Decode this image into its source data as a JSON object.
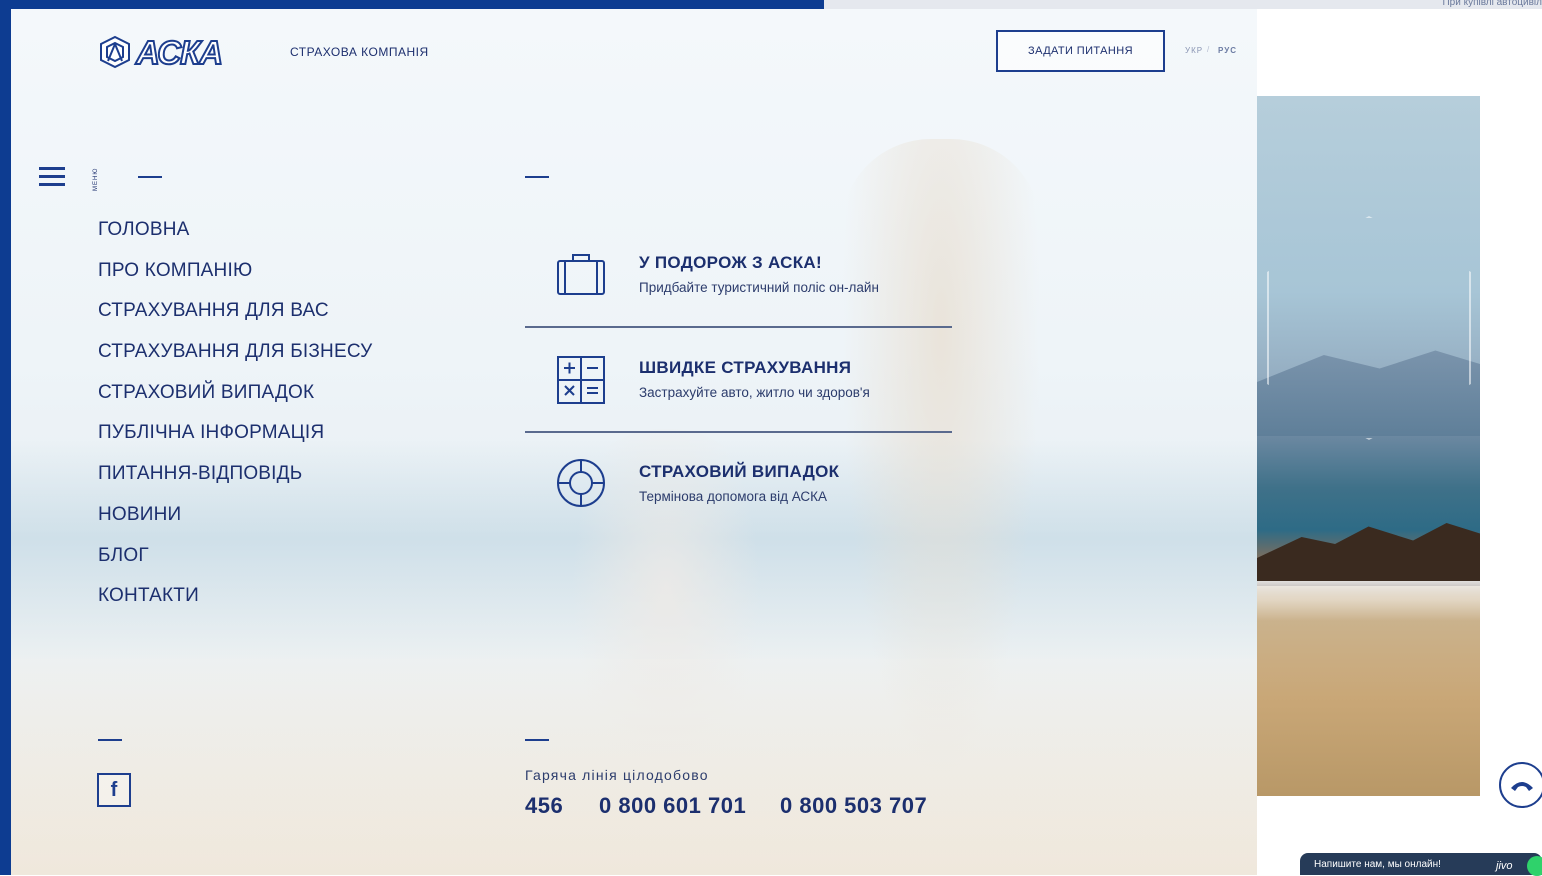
{
  "header": {
    "logo_text": "АСКА",
    "tagline": "СТРАХОВА КОМПАНІЯ",
    "ask_button": "ЗАДАТИ ПИТАННЯ",
    "lang_ukr": "УКР",
    "lang_separator": "/",
    "lang_rus": "РУС",
    "top_right_text": "При купівлі автоцивіл"
  },
  "menu": {
    "label": "МЕНЮ",
    "items": [
      {
        "label": "ГОЛОВНА"
      },
      {
        "label": "ПРО КОМПАНІЮ"
      },
      {
        "label": "СТРАХУВАННЯ ДЛЯ ВАС"
      },
      {
        "label": "СТРАХУВАННЯ ДЛЯ БІЗНЕСУ"
      },
      {
        "label": "СТРАХОВИЙ ВИПАДОК"
      },
      {
        "label": "ПУБЛІЧНА ІНФОРМАЦІЯ"
      },
      {
        "label": "ПИТАННЯ-ВІДПОВІДЬ"
      },
      {
        "label": "НОВИНИ"
      },
      {
        "label": "БЛОГ"
      },
      {
        "label": "КОНТАКТИ"
      }
    ]
  },
  "quick_actions": [
    {
      "title": "У ПОДОРОЖ З АСКА!",
      "subtitle": "Придбайте туристичний поліс он-лайн",
      "icon": "suitcase-icon"
    },
    {
      "title": "ШВИДКЕ СТРАХУВАННЯ",
      "subtitle": "Застрахуйте авто, житло чи здоров'я",
      "icon": "calculator-icon"
    },
    {
      "title": "СТРАХОВИЙ ВИПАДОК",
      "subtitle": "Термінова допомога від АСКА",
      "icon": "lifebuoy-icon"
    }
  ],
  "footer": {
    "social_icon": "facebook-icon",
    "social_glyph": "f",
    "hotline_label": "Гаряча лінія цілодобово",
    "phones": [
      "456",
      "0 800 601 701",
      "0 800 503 707"
    ]
  },
  "widgets": {
    "chat_text": "Напишите нам, мы онлайн!",
    "chat_brand": "jivo"
  },
  "colors": {
    "brand_blue": "#1d3e8e",
    "frame_blue": "#0d3c91",
    "chat_bg": "#263b58",
    "online_green": "#2fd26b"
  }
}
